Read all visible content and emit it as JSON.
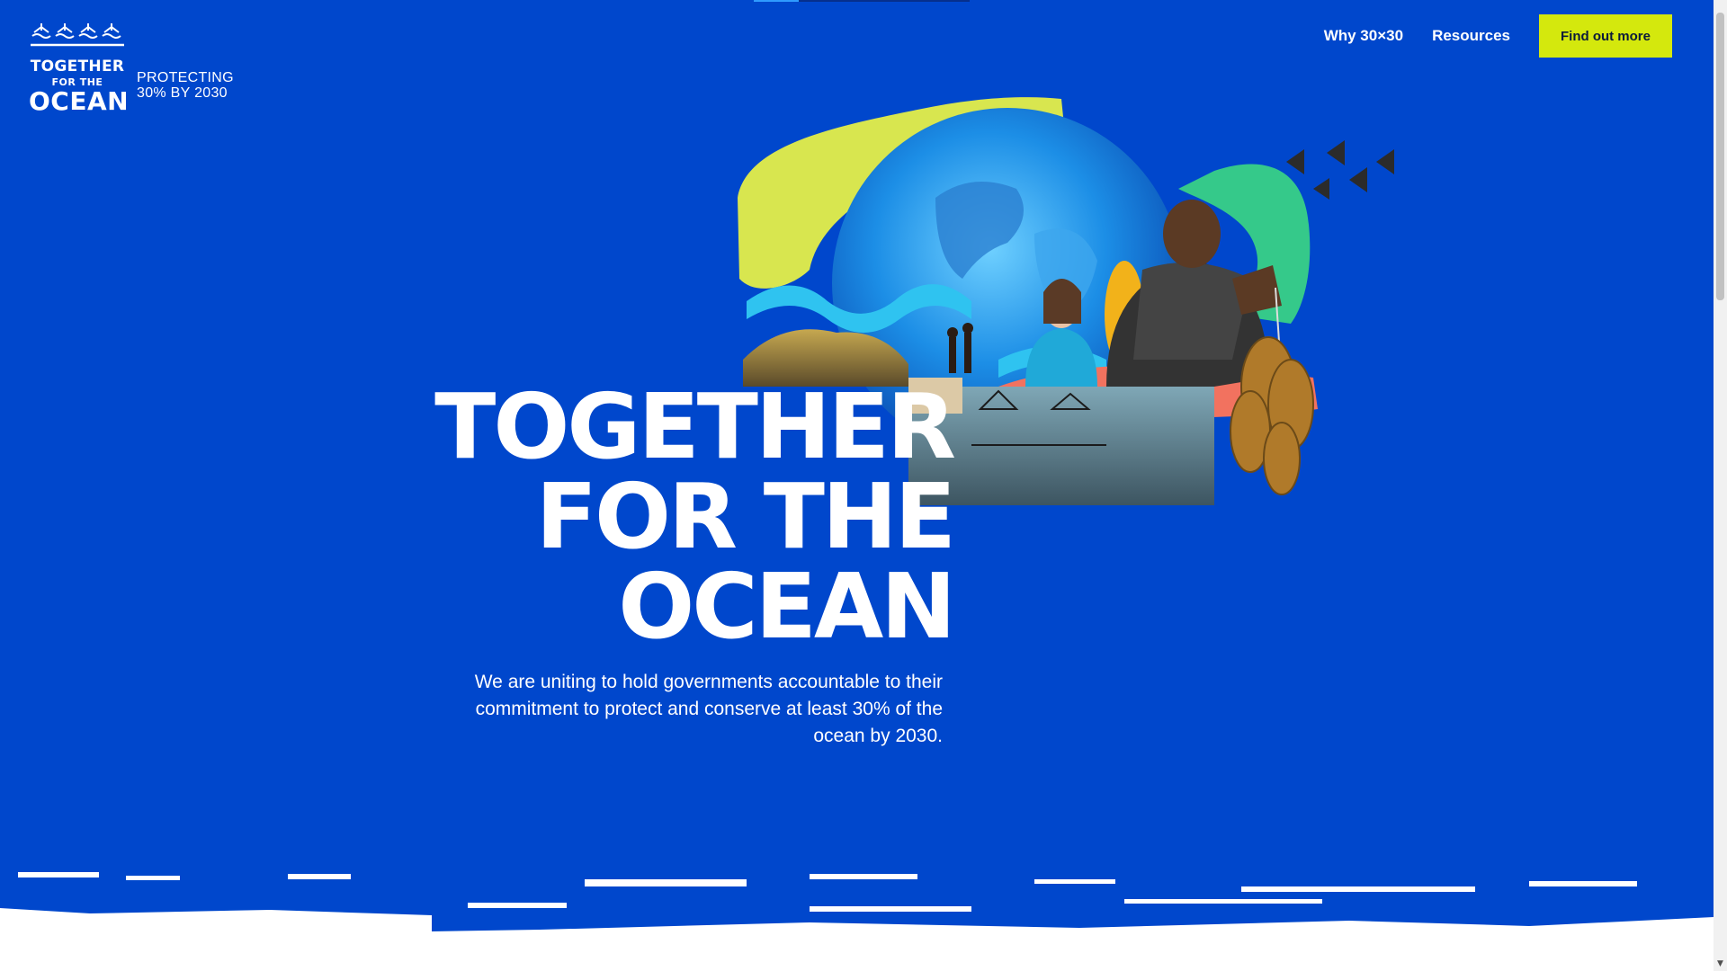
{
  "logo": {
    "line1": "TOGETHER",
    "line2": "FOR THE",
    "line3": "OCEAN",
    "tagline_1": "PROTECTING",
    "tagline_2": "30% BY 2030"
  },
  "nav": {
    "links": [
      "Why 30×30",
      "Resources"
    ],
    "cta": "Find out more"
  },
  "hero": {
    "title_1": "TOGETHER",
    "title_2": "FOR THE",
    "title_3": "OCEAN",
    "subtitle": "We are uniting to hold governments accountable to their commitment to protect and conserve at least 30% of the ocean by 2030."
  },
  "colors": {
    "background": "#0047cc",
    "cta": "#d4e80d",
    "accent_lime": "#d8e64f",
    "accent_green": "#35c98a",
    "accent_coral": "#f2725f",
    "accent_cyan": "#2fc3f0"
  },
  "scrollbar": {
    "down_arrow": "▼"
  }
}
